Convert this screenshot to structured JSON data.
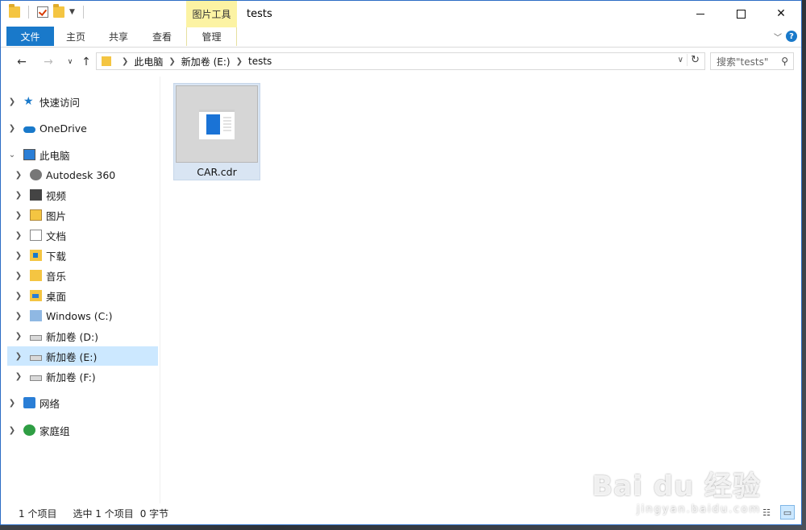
{
  "window": {
    "title": "tests"
  },
  "ribbon": {
    "context_tab": "图片工具",
    "tabs": [
      "文件",
      "主页",
      "共享",
      "查看",
      "管理"
    ]
  },
  "address": {
    "breadcrumb": [
      "此电脑",
      "新加卷 (E:)",
      "tests"
    ],
    "search_placeholder": "搜索\"tests\""
  },
  "sidebar": {
    "items": [
      {
        "label": "快速访问",
        "icon": "star-icon",
        "level": 1,
        "expanded": false,
        "selected": false
      },
      {
        "label": "OneDrive",
        "icon": "cloud-icon",
        "level": 1,
        "expanded": false,
        "selected": false
      },
      {
        "label": "此电脑",
        "icon": "computer-icon",
        "level": 1,
        "expanded": true,
        "selected": false
      },
      {
        "label": "Autodesk 360",
        "icon": "autodesk-icon",
        "level": 2,
        "expanded": false,
        "selected": false
      },
      {
        "label": "视频",
        "icon": "video-folder-icon",
        "level": 2,
        "expanded": false,
        "selected": false
      },
      {
        "label": "图片",
        "icon": "pictures-folder-icon",
        "level": 2,
        "expanded": false,
        "selected": false
      },
      {
        "label": "文档",
        "icon": "documents-folder-icon",
        "level": 2,
        "expanded": false,
        "selected": false
      },
      {
        "label": "下载",
        "icon": "downloads-folder-icon",
        "level": 2,
        "expanded": false,
        "selected": false
      },
      {
        "label": "音乐",
        "icon": "music-folder-icon",
        "level": 2,
        "expanded": false,
        "selected": false
      },
      {
        "label": "桌面",
        "icon": "desktop-folder-icon",
        "level": 2,
        "expanded": false,
        "selected": false
      },
      {
        "label": "Windows (C:)",
        "icon": "windows-drive-icon",
        "level": 2,
        "expanded": false,
        "selected": false
      },
      {
        "label": "新加卷 (D:)",
        "icon": "drive-icon",
        "level": 2,
        "expanded": false,
        "selected": false
      },
      {
        "label": "新加卷 (E:)",
        "icon": "drive-icon",
        "level": 2,
        "expanded": false,
        "selected": true
      },
      {
        "label": "新加卷 (F:)",
        "icon": "drive-icon",
        "level": 2,
        "expanded": false,
        "selected": false
      },
      {
        "label": "网络",
        "icon": "network-icon",
        "level": 1,
        "expanded": false,
        "selected": false
      },
      {
        "label": "家庭组",
        "icon": "homegroup-icon",
        "level": 1,
        "expanded": false,
        "selected": false
      }
    ]
  },
  "files": [
    {
      "name": "CAR.cdr",
      "icon": "coreldraw-file-icon",
      "selected": true
    }
  ],
  "status": {
    "count": "1 个项目",
    "selection": "选中 1 个项目",
    "size": "0 字节"
  },
  "watermark": {
    "brand": "Bai du 经验",
    "url": "jingyan.baidu.com"
  },
  "colors": {
    "accent": "#1979ca",
    "context_tab": "#fcf3a3",
    "selection": "#cce8ff"
  }
}
